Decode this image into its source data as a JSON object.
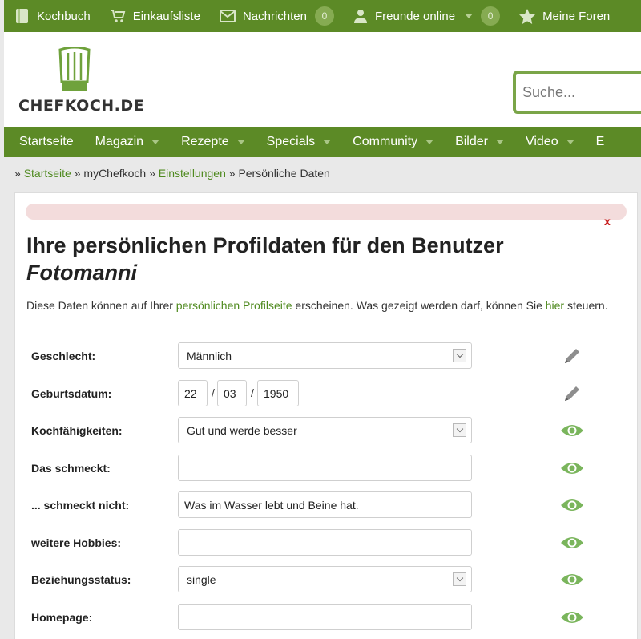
{
  "topbar": {
    "items": [
      {
        "label": "Kochbuch",
        "icon": "book-icon"
      },
      {
        "label": "Einkaufsliste",
        "icon": "cart-icon"
      },
      {
        "label": "Nachrichten",
        "icon": "envelope-icon",
        "count": "0"
      },
      {
        "label": "Freunde online",
        "icon": "person-icon",
        "count": "0"
      },
      {
        "label": "Meine Foren",
        "icon": "star-icon"
      }
    ]
  },
  "header": {
    "logo_text": "CHEFKOCH.DE",
    "search_placeholder": "Suche..."
  },
  "mainnav": {
    "items": [
      "Startseite",
      "Magazin",
      "Rezepte",
      "Specials",
      "Community",
      "Bilder",
      "Video",
      "E"
    ]
  },
  "breadcrumb": {
    "startseite": "Startseite",
    "mychefkoch": "myChefkoch",
    "einstellungen": "Einstellungen",
    "current": "Persönliche Daten",
    "separator": "»"
  },
  "page": {
    "close_symbol": "x",
    "title_prefix": "Ihre persönlichen Profildaten für den Benutzer",
    "username": "Fotomanni",
    "intro_part1": "Diese Daten können auf Ihrer ",
    "intro_link1": "persönlichen Profilseite",
    "intro_part2": " erscheinen. Was gezeigt werden darf, können Sie ",
    "intro_link2": "hier",
    "intro_part3": " steuern."
  },
  "form": {
    "geschlecht": {
      "label": "Geschlecht:",
      "value": "Männlich",
      "icon": "pencil-icon"
    },
    "geburtsdatum": {
      "label": "Geburtsdatum:",
      "day": "22",
      "month": "03",
      "year": "1950",
      "separator": "/",
      "icon": "pencil-icon"
    },
    "kochfaehigkeiten": {
      "label": "Kochfähigkeiten:",
      "value": "Gut und werde besser",
      "icon": "eye-icon"
    },
    "schmeckt": {
      "label": "Das schmeckt:",
      "value": "",
      "icon": "eye-icon"
    },
    "schmeckt_nicht": {
      "label": "... schmeckt nicht:",
      "value": "Was im Wasser lebt und Beine hat.",
      "icon": "eye-icon"
    },
    "hobbies": {
      "label": "weitere Hobbies:",
      "value": "",
      "icon": "eye-icon"
    },
    "beziehungsstatus": {
      "label": "Beziehungsstatus:",
      "value": "single",
      "icon": "eye-icon"
    },
    "homepage": {
      "label": "Homepage:",
      "value": "",
      "icon": "eye-icon"
    }
  },
  "colors": {
    "brand_green": "#5c8a26",
    "link_green": "#4f8a1f",
    "eye_green": "#7ab55c",
    "pencil_gray": "#888888",
    "close_red": "#c81e1e",
    "alert_bg": "#f3dcdc"
  }
}
